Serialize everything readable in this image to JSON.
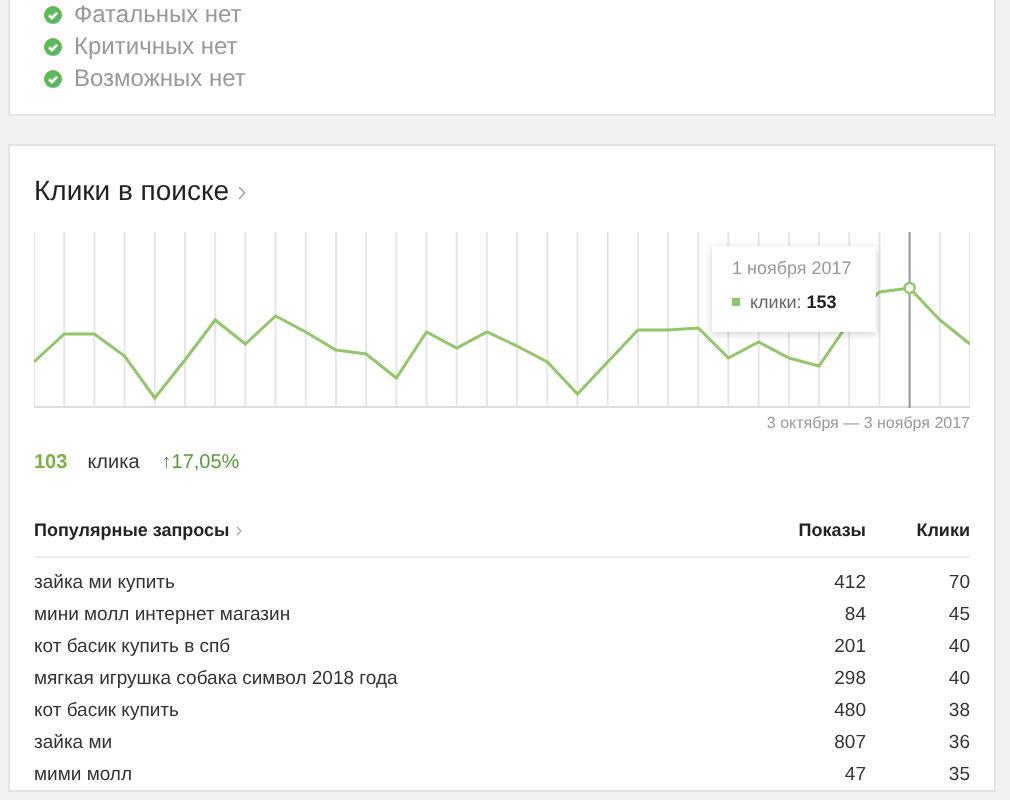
{
  "checks": [
    {
      "label": "Фатальных нет",
      "ok": true
    },
    {
      "label": "Критичных нет",
      "ok": true
    },
    {
      "label": "Возможных нет",
      "ok": true
    }
  ],
  "clicks_card": {
    "title": "Клики в поиске",
    "tooltip": {
      "date": "1 ноября 2017",
      "value": "клики: **153**"
    },
    "period": "3 октября — 3 ноября 2017",
    "total": "103",
    "unit": "клика",
    "change": "↑17,05%"
  },
  "queries": {
    "columns": [
      "Популярные запросы",
      "Показы",
      "Клики"
    ],
    "rows": [
      [
        "зайка ми купить",
        "412",
        "70"
      ],
      [
        "мини молл интернет магазин",
        "84",
        "45"
      ],
      [
        "кот басик купить в спб",
        "201",
        "40"
      ],
      [
        "мягкая игрушка собака символ 2018 года",
        "298",
        "40"
      ],
      [
        "кот басик купить",
        "480",
        "38"
      ],
      [
        "зайка ми",
        "807",
        "36"
      ],
      [
        "мими молл",
        "47",
        "35"
      ]
    ]
  }
}
